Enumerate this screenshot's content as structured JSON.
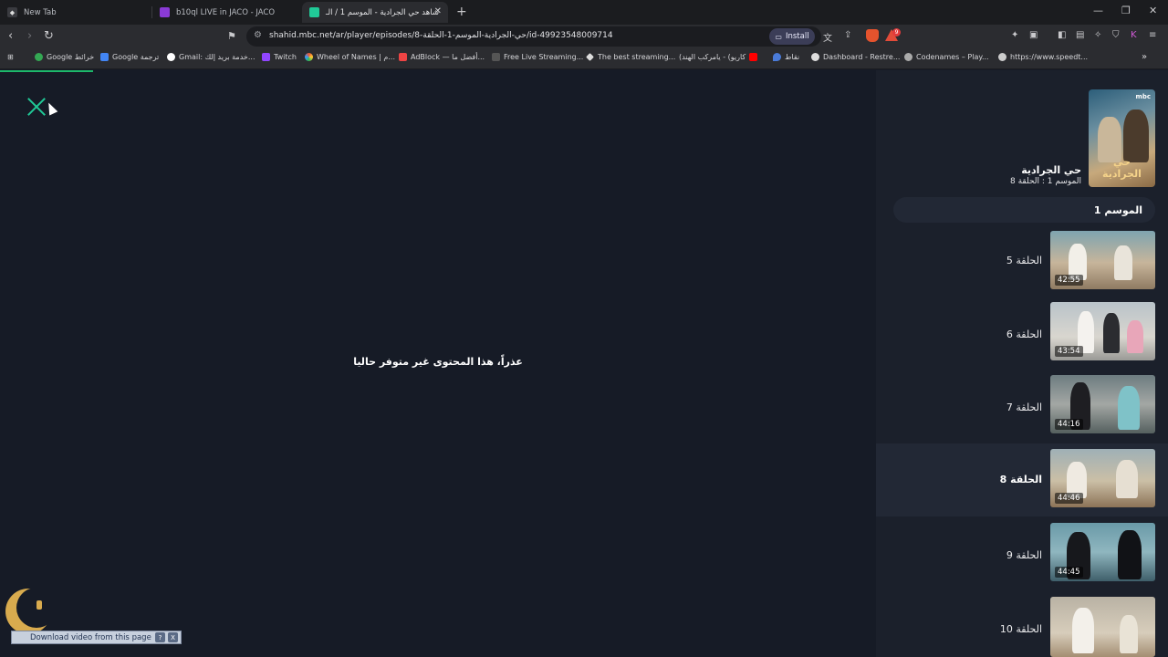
{
  "browser": {
    "tabs": [
      {
        "title": "New Tab",
        "active": false
      },
      {
        "title": "b10ql LIVE in JACO - JACO",
        "active": false
      },
      {
        "title": "شاهد حي الجرادية - الموسم 1 / الـ",
        "active": true
      }
    ],
    "url": "shahid.mbc.net/ar/player/episodes/حي-الجرادية-الموسم-1-الحلقة-8/id-49923548009714",
    "install_label": "Install",
    "notification_count": "9",
    "bookmarks": [
      "Google خرائط",
      "Google ترجمة",
      "Gmail: خدمة بريد إلك...",
      "Twitch",
      "Wheel of Names | م...",
      "AdBlock — أفضل ما...",
      "Free Live Streaming...",
      "The best streaming...",
      "كاريو) - يامركب الهند)",
      "نقاط",
      "Dashboard - Restre...",
      "Codenames – Play...",
      "https://www.speedt..."
    ]
  },
  "player": {
    "error_message": "عذراً، هذا المحتوى غير متوفر حاليا"
  },
  "sidebar": {
    "poster_brand": "mbc",
    "poster_title": "حي الجرادية",
    "show_title": "حي الجرادية",
    "show_subtitle": "الموسم 1 : الحلقة 8",
    "season_label": "الموسم 1",
    "episodes": [
      {
        "label": "الحلقة 5",
        "duration": "42:55",
        "active": false
      },
      {
        "label": "الحلقة 6",
        "duration": "43:54",
        "active": false
      },
      {
        "label": "الحلقة 7",
        "duration": "44:16",
        "active": false
      },
      {
        "label": "الحلقة 8",
        "duration": "44:46",
        "active": true
      },
      {
        "label": "الحلقة 9",
        "duration": "44:45",
        "active": false
      },
      {
        "label": "الحلقة 10",
        "duration": "",
        "active": false
      }
    ]
  },
  "download_bar": {
    "label": "Download video from this page",
    "help": "?",
    "close": "X"
  },
  "colors": {
    "accent": "#20c997",
    "background": "#161b26",
    "sidebar": "#1b202b",
    "active_row": "#222835"
  }
}
